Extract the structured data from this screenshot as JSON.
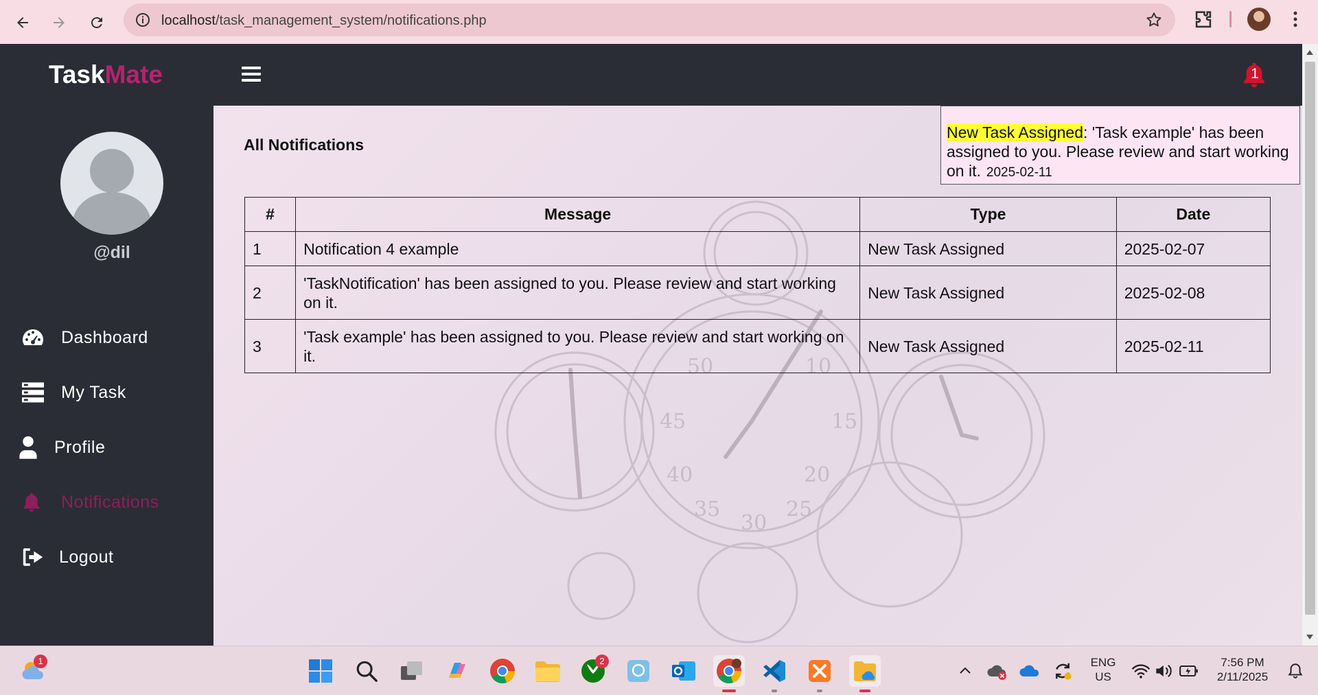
{
  "browser": {
    "url_host": "localhost",
    "url_path": "/task_management_system/notifications.php"
  },
  "app": {
    "brand_part1": "Task",
    "brand_part2": "Mate",
    "bell_count": "1",
    "colors": {
      "accent": "#b4236f",
      "sidebar_bg": "#2a2d35",
      "popup_bg": "#fde5f4",
      "highlight": "#ffff33"
    }
  },
  "sidebar": {
    "username": "@dil",
    "items": [
      {
        "label": "Dashboard",
        "icon": "gauge-icon"
      },
      {
        "label": "My Task",
        "icon": "task-list-icon"
      },
      {
        "label": "Profile",
        "icon": "user-icon"
      },
      {
        "label": "Notifications",
        "icon": "bell-icon",
        "active": true
      },
      {
        "label": "Logout",
        "icon": "logout-icon"
      }
    ]
  },
  "main": {
    "title": "All Notifications",
    "table": {
      "headers": [
        "#",
        "Message",
        "Type",
        "Date"
      ],
      "rows": [
        {
          "num": "1",
          "message": "Notification 4 example",
          "type": "New Task Assigned",
          "date": "2025-02-07"
        },
        {
          "num": "2",
          "message": "'TaskNotification' has been assigned to you. Please review and start working on it.",
          "type": "New Task Assigned",
          "date": "2025-02-08"
        },
        {
          "num": "3",
          "message": "'Task example' has been assigned to you. Please review and start working on it.",
          "type": "New Task Assigned",
          "date": "2025-02-11"
        }
      ]
    }
  },
  "popup": {
    "highlight": "New Task Assigned",
    "message": ": 'Task example' has been assigned to you. Please review and start working on it.",
    "date": "2025-02-11"
  },
  "taskbar": {
    "weather_badge": "1",
    "xbox_badge": "2",
    "lang_top": "ENG",
    "lang_bottom": "US",
    "time": "7:56 PM",
    "date": "2/11/2025"
  }
}
